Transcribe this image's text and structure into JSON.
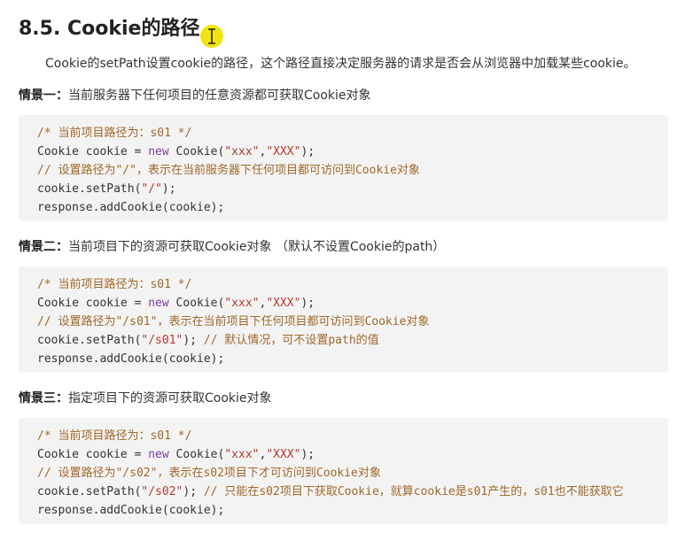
{
  "heading": "8.5. Cookie的路径",
  "intro": "Cookie的setPath设置cookie的路径，这个路径直接决定服务器的请求是否会从浏览器中加载某些cookie。",
  "sections": [
    {
      "label": "情景一：",
      "text": "当前服务器下任何项目的任意资源都可获取Cookie对象",
      "lines": [
        {
          "parts": [
            {
              "t": "/* 当前项目路径为：s01 */",
              "c": "cm"
            }
          ]
        },
        {
          "parts": [
            {
              "t": "Cookie cookie = ",
              "c": ""
            },
            {
              "t": "new",
              "c": "kw"
            },
            {
              "t": " Cookie(",
              "c": ""
            },
            {
              "t": "\"xxx\"",
              "c": "str"
            },
            {
              "t": ",",
              "c": ""
            },
            {
              "t": "\"XXX\"",
              "c": "str"
            },
            {
              "t": ");",
              "c": ""
            }
          ]
        },
        {
          "parts": [
            {
              "t": "// 设置路径为\"/\"，表示在当前服务器下任何项目都可访问到Cookie对象",
              "c": "cm"
            }
          ]
        },
        {
          "parts": [
            {
              "t": "cookie.setPath(",
              "c": ""
            },
            {
              "t": "\"/\"",
              "c": "str"
            },
            {
              "t": ");",
              "c": ""
            }
          ]
        },
        {
          "parts": [
            {
              "t": "response.addCookie(cookie);",
              "c": ""
            }
          ]
        }
      ]
    },
    {
      "label": "情景二：",
      "text": "当前项目下的资源可获取Cookie对象 （默认不设置Cookie的path）",
      "lines": [
        {
          "parts": [
            {
              "t": "/* 当前项目路径为：s01 */",
              "c": "cm"
            }
          ]
        },
        {
          "parts": [
            {
              "t": "Cookie cookie = ",
              "c": ""
            },
            {
              "t": "new",
              "c": "kw"
            },
            {
              "t": " Cookie(",
              "c": ""
            },
            {
              "t": "\"xxx\"",
              "c": "str"
            },
            {
              "t": ",",
              "c": ""
            },
            {
              "t": "\"XXX\"",
              "c": "str"
            },
            {
              "t": ");",
              "c": ""
            }
          ]
        },
        {
          "parts": [
            {
              "t": "// 设置路径为\"/s01\"，表示在当前项目下任何项目都可访问到Cookie对象",
              "c": "cm"
            }
          ]
        },
        {
          "parts": [
            {
              "t": "cookie.setPath(",
              "c": ""
            },
            {
              "t": "\"/s01\"",
              "c": "str"
            },
            {
              "t": "); ",
              "c": ""
            },
            {
              "t": "// 默认情况，可不设置path的值",
              "c": "cm"
            }
          ]
        },
        {
          "parts": [
            {
              "t": "response.addCookie(cookie);",
              "c": ""
            }
          ]
        }
      ]
    },
    {
      "label": "情景三：",
      "text": "指定项目下的资源可获取Cookie对象",
      "lines": [
        {
          "parts": [
            {
              "t": "/* 当前项目路径为：s01 */",
              "c": "cm"
            }
          ]
        },
        {
          "parts": [
            {
              "t": "Cookie cookie = ",
              "c": ""
            },
            {
              "t": "new",
              "c": "kw"
            },
            {
              "t": " Cookie(",
              "c": ""
            },
            {
              "t": "\"xxx\"",
              "c": "str"
            },
            {
              "t": ",",
              "c": ""
            },
            {
              "t": "\"XXX\"",
              "c": "str"
            },
            {
              "t": ");",
              "c": ""
            }
          ]
        },
        {
          "parts": [
            {
              "t": "// 设置路径为\"/s02\"，表示在s02项目下才可访问到Cookie对象",
              "c": "cm"
            }
          ]
        },
        {
          "parts": [
            {
              "t": "cookie.setPath(",
              "c": ""
            },
            {
              "t": "\"/s02\"",
              "c": "str"
            },
            {
              "t": "); ",
              "c": ""
            },
            {
              "t": "// 只能在s02项目下获取Cookie，就算cookie是s01产生的，s01也不能获取它",
              "c": "cm"
            }
          ]
        },
        {
          "parts": [
            {
              "t": "response.addCookie(cookie);",
              "c": ""
            }
          ]
        }
      ]
    }
  ]
}
